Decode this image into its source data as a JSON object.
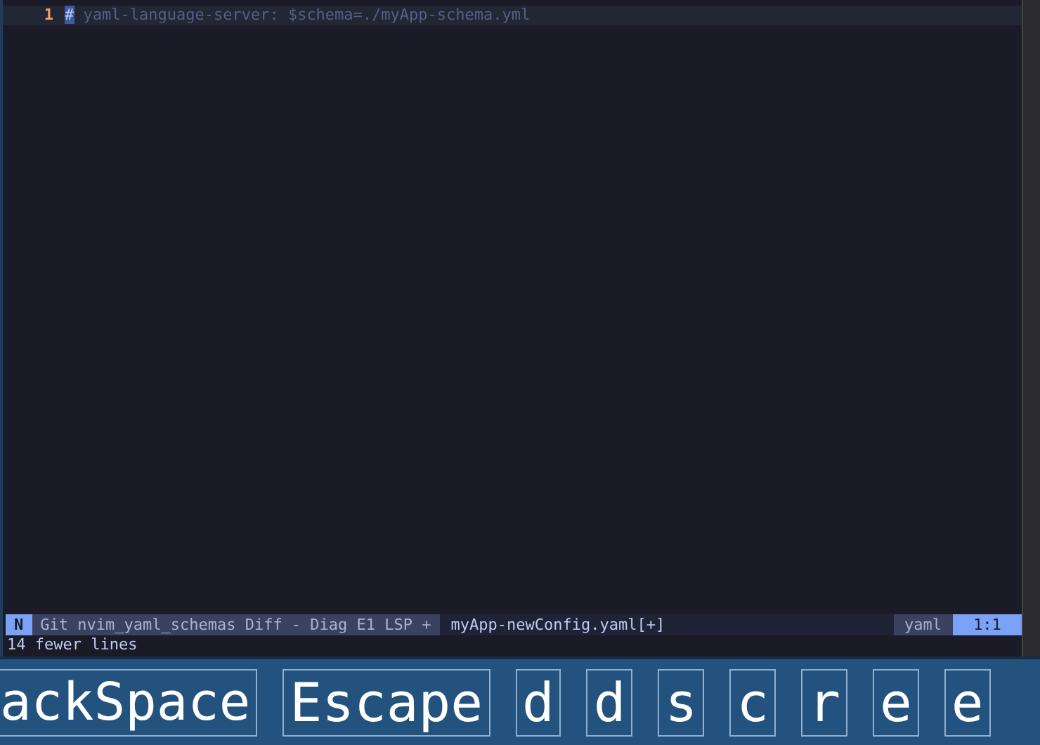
{
  "editor": {
    "lines": [
      {
        "number": "1",
        "text": "# yaml-language-server: $schema=./myApp-schema.yml",
        "current": true
      }
    ]
  },
  "status_line": {
    "mode": "N",
    "git": "Git nvim_yaml_schemas Diff - Diag E1 LSP +",
    "file": "myApp-newConfig.yaml[+]",
    "filetype": "yaml",
    "position": "1:1"
  },
  "message": "14 fewer lines",
  "keys": [
    {
      "label": "ackSpace",
      "cut": true
    },
    {
      "label": "Escape",
      "cut": false
    },
    {
      "label": "d",
      "cut": false
    },
    {
      "label": "d",
      "cut": false
    },
    {
      "label": "s",
      "cut": false
    },
    {
      "label": "c",
      "cut": false
    },
    {
      "label": "r",
      "cut": false
    },
    {
      "label": "e",
      "cut": false
    },
    {
      "label": "e",
      "cut": false
    }
  ]
}
